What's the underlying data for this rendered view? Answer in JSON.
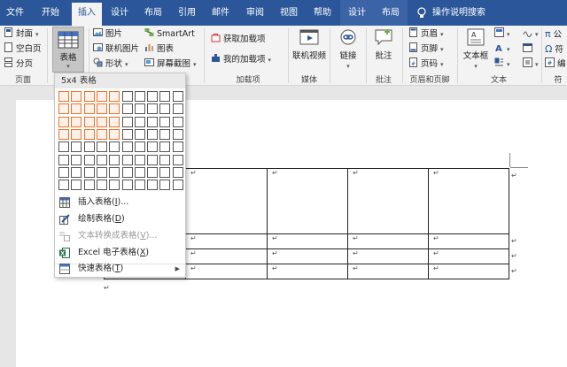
{
  "tabs": [
    "文件",
    "开始",
    "插入",
    "设计",
    "布局",
    "引用",
    "邮件",
    "审阅",
    "视图",
    "帮助",
    "设计",
    "布局"
  ],
  "active_tab": "插入",
  "tell_me": "操作说明搜索",
  "groups": {
    "pages": {
      "label": "页面",
      "cover": "封面",
      "blank": "空白页",
      "break": "分页"
    },
    "tables": {
      "button": "表格"
    },
    "illustrations": {
      "pictures": "图片",
      "online_pictures": "联机图片",
      "shapes": "形状",
      "smartart": "SmartArt",
      "chart": "图表",
      "screenshot": "屏幕截图"
    },
    "addins": {
      "label": "加载项",
      "get": "获取加载项",
      "mine": "我的加载项"
    },
    "media": {
      "label": "媒体",
      "online_video": "联机视频"
    },
    "links": {
      "label": "",
      "link": "链接"
    },
    "comments": {
      "label": "批注",
      "comment": "批注"
    },
    "header_footer": {
      "label": "页眉和页脚",
      "header": "页眉",
      "footer": "页脚",
      "page_number": "页码"
    },
    "text": {
      "label": "文本",
      "textbox": "文本框",
      "quick_parts": "A"
    },
    "symbols": {
      "label": "符",
      "equation": "公",
      "symbol": "符",
      "edit": "编"
    }
  },
  "dropdown": {
    "header": "5x4 表格",
    "grid_rows": 8,
    "grid_cols": 10,
    "selected_cols": 5,
    "selected_rows": 4,
    "items": [
      {
        "label": "插入表格(",
        "key": "I",
        "suffix": ")...",
        "icon": "table-grid-icon",
        "disabled": false
      },
      {
        "label": "绘制表格(",
        "key": "D",
        "suffix": ")",
        "icon": "draw-table-icon",
        "disabled": false
      },
      {
        "label": "文本转换成表格(",
        "key": "V",
        "suffix": ")...",
        "icon": "convert-text-icon",
        "disabled": true
      },
      {
        "label": "Excel 电子表格(",
        "key": "X",
        "suffix": ")",
        "icon": "excel-icon",
        "disabled": false
      },
      {
        "label": "快速表格(",
        "key": "T",
        "suffix": ")",
        "icon": "quick-table-icon",
        "disabled": false
      }
    ]
  },
  "document": {
    "cell_mark": "↵"
  },
  "colors": {
    "ribbon_blue": "#2b579a",
    "grid_highlight": "#e8742a"
  }
}
